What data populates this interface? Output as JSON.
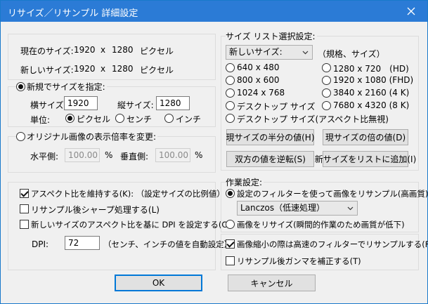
{
  "window": {
    "title": "リサイズ／リサンプル 詳細設定"
  },
  "current_size": {
    "label": "現在のサイズ:",
    "width": "1920",
    "sep": "x",
    "height": "1280",
    "unit": "ピクセル"
  },
  "new_size": {
    "label": "新しいサイズ:",
    "width": "1920",
    "sep": "x",
    "height": "1280",
    "unit": "ピクセル"
  },
  "specify_group": {
    "legend": "新規でサイズを指定:",
    "width_label": "横サイズ:",
    "width_value": "1920",
    "height_label": "縦サイズ:",
    "height_value": "1280",
    "unit_label": "単位:",
    "units": [
      "ピクセル",
      "センチ",
      "インチ"
    ]
  },
  "ratio_group": {
    "legend": "オリジナル画像の表示倍率を変更:",
    "horizontal_label": "水平側:",
    "horizontal_value": "100.00",
    "vertical_label": "垂直側:",
    "vertical_value": "100.00",
    "percent": "%"
  },
  "options": {
    "keep_aspect": "アスペクト比を維持する(K): （設定サイズの比例値）",
    "sharpen": "リサンプル後シャープ処理する(L)",
    "dpi_from_aspect": "新しいサイズのアスペクト比を基に DPI を設定する(C)",
    "dpi_label": "DPI:",
    "dpi_value": "72",
    "dpi_note": "（センチ、インチの値を自動設定）"
  },
  "size_list": {
    "legend": "サイズ リスト選択設定:",
    "select_value": "新しいサイズ:",
    "select_hint": "（規格、サイズ）",
    "left_col": [
      "640 x 480",
      "800 x 600",
      "1024 x 768",
      "デスクトップ サイズ"
    ],
    "right_col": [
      "1280 x 720　(HD)",
      "1920 x 1080 (FHD)",
      "3840 x 2160 (4 K)",
      "7680 x 4320 (8 K)"
    ],
    "desktop_aspect": "デスクトップ サイズ(アスペクト比無視)",
    "btn_half": "現サイズの半分の値(H)",
    "btn_double": "現サイズの倍の値(D)",
    "btn_swap": "双方の値を逆転(S)",
    "btn_add": "新サイズをリストに追加(I)"
  },
  "work_settings": {
    "legend": "作業設定:",
    "resample": "設定のフィルターを使って画像をリサンプル(高画質):",
    "filter_value": "Lanczos（低速処理）",
    "resize": "画像をリサイズ(瞬間的作業のため画質が低下)",
    "high_speed_filter": "画像縮小の際は高速のフィルターでリサンプルする(F)",
    "gamma": "リサンプル後ガンマを補正する(T)"
  },
  "buttons": {
    "ok": "OK",
    "cancel": "キャンセル"
  }
}
